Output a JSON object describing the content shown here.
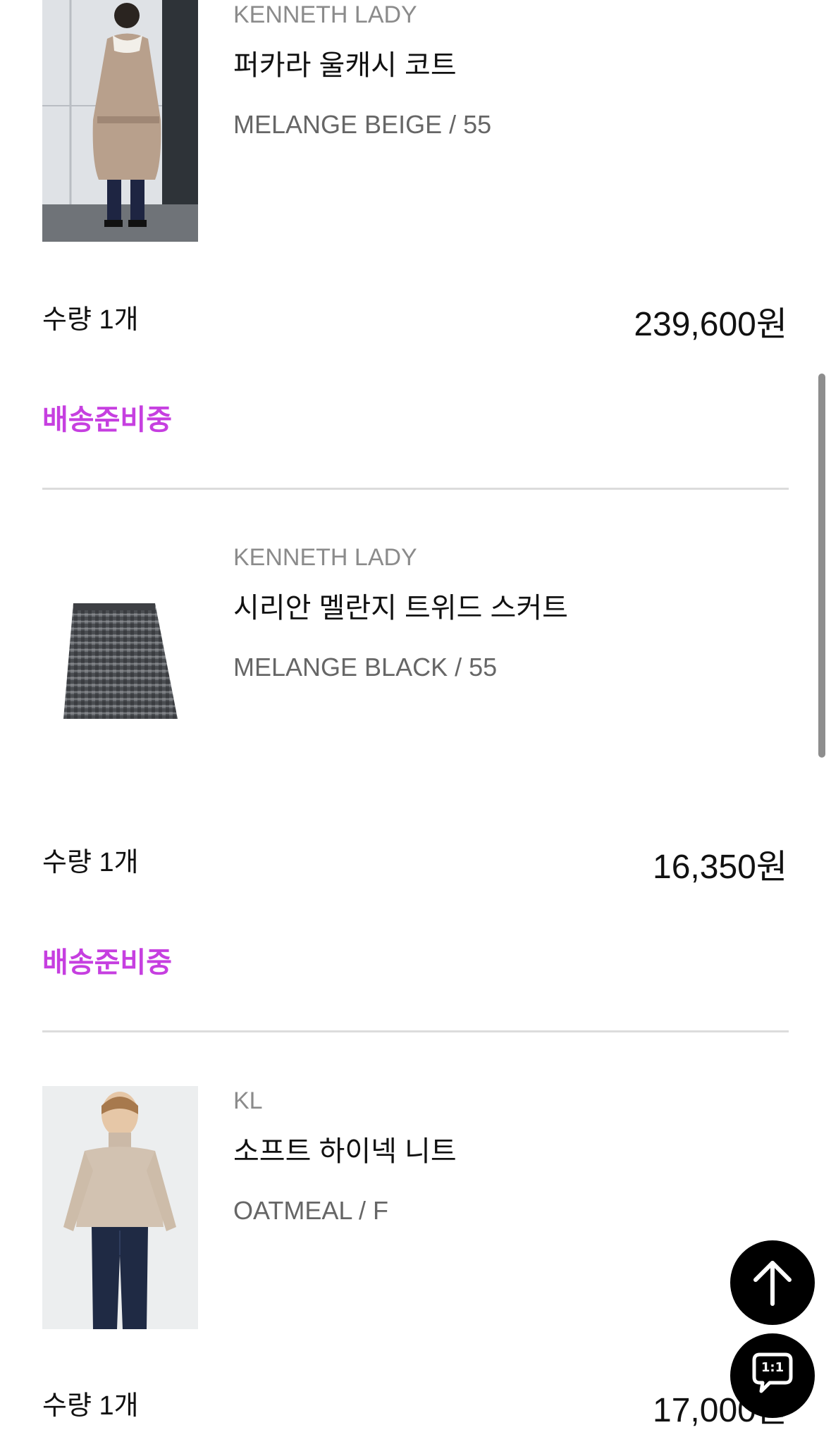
{
  "colors": {
    "status": "#c63fe0",
    "divider": "#dcdcdc",
    "fab_bg": "#000000"
  },
  "items": [
    {
      "brand": "KENNETH LADY",
      "name": "퍼카라 울캐시 코트",
      "option": "MELANGE BEIGE / 55",
      "quantity": "수량 1개",
      "price": "239,600원",
      "status": "배송준비중"
    },
    {
      "brand": "KENNETH LADY",
      "name": "시리안 멜란지 트위드 스커트",
      "option": "MELANGE BLACK / 55",
      "quantity": "수량 1개",
      "price": "16,350원",
      "status": "배송준비중"
    },
    {
      "brand": "KL",
      "name": "소프트 하이넥 니트",
      "option": "OATMEAL / F",
      "quantity": "수량 1개",
      "price": "17,000원"
    }
  ],
  "floating_buttons": {
    "scroll_top_icon": "arrow-up-icon",
    "chat_icon": "chat-bubble-icon",
    "chat_label": "1:1"
  }
}
